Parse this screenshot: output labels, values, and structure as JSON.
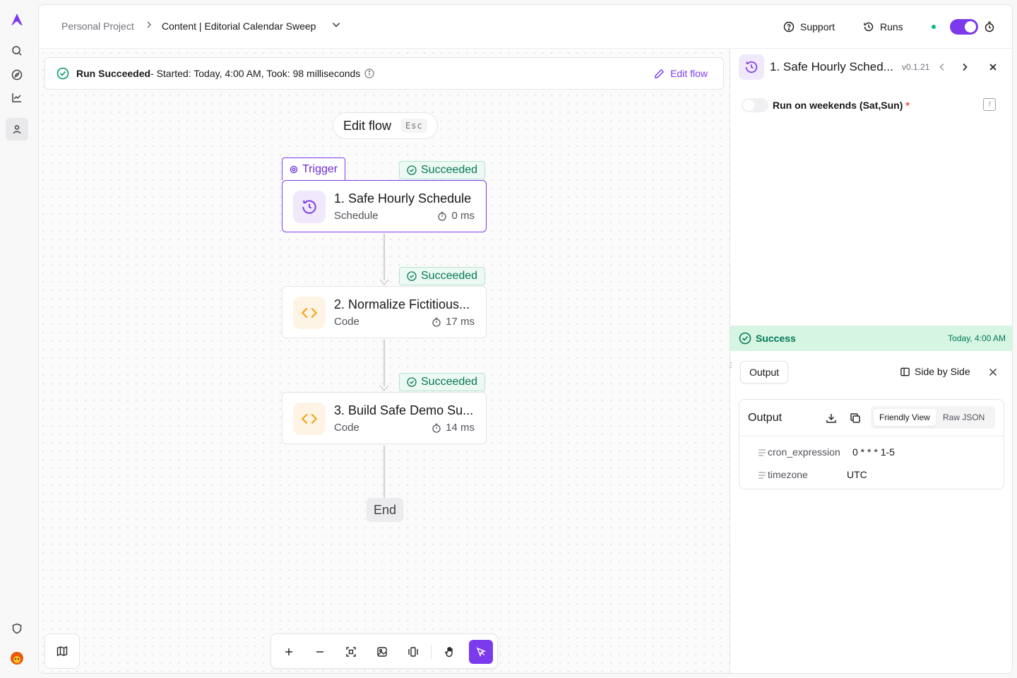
{
  "rail": {
    "icons": [
      "app-logo-icon",
      "search-icon",
      "compass-icon",
      "chart-icon",
      "user-icon",
      "shield-icon",
      "avatar"
    ]
  },
  "header": {
    "breadcrumb_project": "Personal Project",
    "flow_title": "Content | Editorial Calendar Sweep",
    "support_label": "Support",
    "runs_label": "Runs"
  },
  "banner": {
    "status": "Run Succeeded",
    "detail": " - Started: Today, 4:00 AM, Took: 98 milliseconds",
    "edit_flow_label": "Edit flow"
  },
  "canvas": {
    "edit_flow_pill": "Edit flow",
    "esc_key": "Esc",
    "trigger_label": "Trigger",
    "end_label": "End",
    "steps": [
      {
        "title": "1. Safe Hourly Schedule",
        "type": "Schedule",
        "time": "0 ms",
        "status": "Succeeded"
      },
      {
        "title": "2. Normalize Fictitious...",
        "type": "Code",
        "time": "17 ms",
        "status": "Succeeded"
      },
      {
        "title": "3. Build Safe Demo Su...",
        "type": "Code",
        "time": "14 ms",
        "status": "Succeeded"
      }
    ]
  },
  "panel": {
    "title": "1. Safe Hourly Sched...",
    "version": "v0.1.21",
    "weekend_label": "Run on weekends (Sat,Sun)",
    "required_mark": "*",
    "fx_label": "f",
    "success_label": "Success",
    "success_time": "Today, 4:00 AM",
    "output_tab": "Output",
    "side_by_side": "Side by Side",
    "output_card_title": "Output",
    "view_friendly": "Friendly View",
    "view_raw": "Raw JSON",
    "fields": [
      {
        "key": "cron_expression",
        "value": "0 * * * 1-5"
      },
      {
        "key": "timezone",
        "value": "UTC"
      }
    ]
  },
  "colors": {
    "accent": "#7c3aed",
    "success": "#047857",
    "success_bg": "#d6f5e3"
  }
}
